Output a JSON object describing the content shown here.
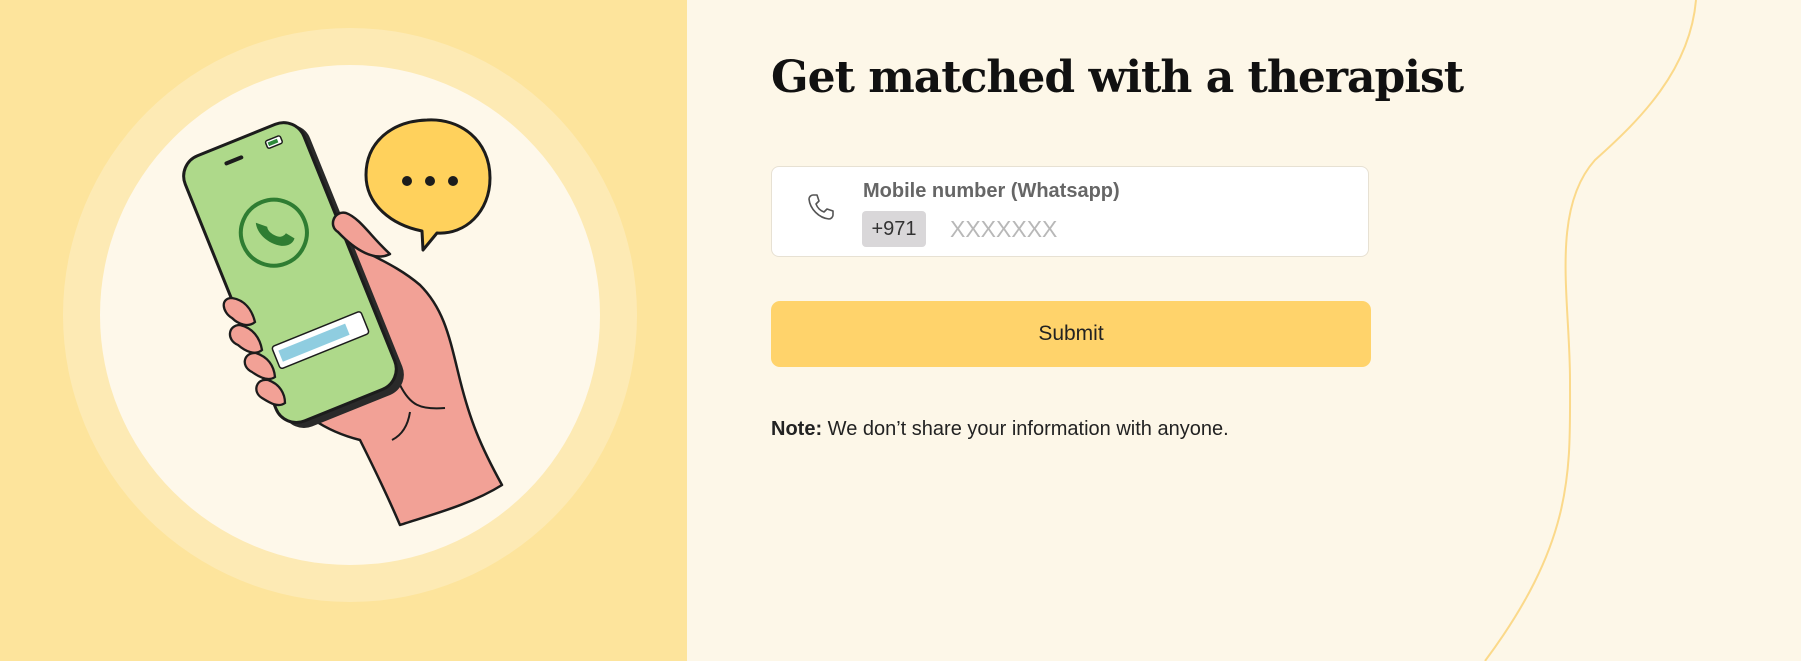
{
  "colors": {
    "left_panel": "#fde49c",
    "page_background": "#fdf7e8",
    "button": "#ffd36b",
    "phone_screen": "#aed98a",
    "hand": "#f2a196",
    "bubble": "#ffd15c"
  },
  "illustration": {
    "icons": [
      "phone-in-hand-illustration",
      "chat-bubble-icon",
      "call-icon"
    ]
  },
  "form": {
    "heading": "Get matched with a therapist",
    "phone_label": "Mobile number (Whatsapp)",
    "country_code": "+971",
    "phone_placeholder": "XXXXXXX",
    "phone_value": "",
    "submit_label": "Submit",
    "note_label": "Note:",
    "note_text": "We don’t share your information with anyone."
  }
}
